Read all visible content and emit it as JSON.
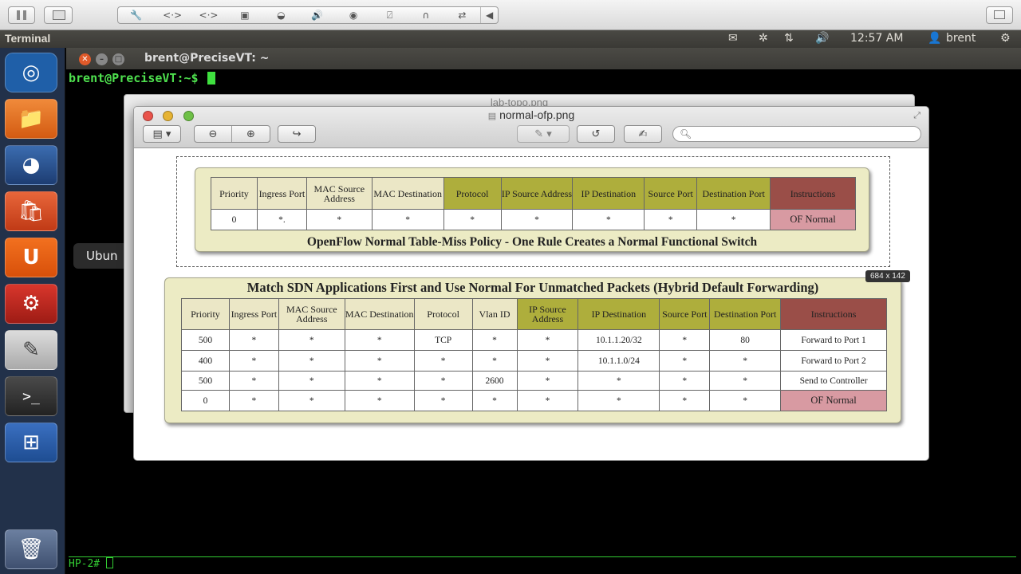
{
  "terminal": {
    "window_title": "brent@PreciseVT: ~",
    "prompt": "brent@PreciseVT:~$",
    "bottom_prompt": "HP-2#"
  },
  "top_panel": {
    "app_name": "Terminal",
    "time": "12:57 AM",
    "user": "brent"
  },
  "launcher": {
    "tooltip": "Ubun",
    "items": [
      "ubuntu-dash",
      "files",
      "firefox",
      "software-center",
      "ubuntu-one",
      "system-settings",
      "text-editor",
      "terminal",
      "workspace-switcher",
      "trash"
    ]
  },
  "preview": {
    "back_title": "lab-topo.png",
    "front_title": "normal-ofp.png",
    "selection_size": "684 x 142"
  },
  "table1": {
    "headers": [
      "Priority",
      "Ingress Port",
      "MAC Source Address",
      "MAC Destination",
      "Protocol",
      "IP Source Address",
      "IP Destination",
      "Source Port",
      "Destination Port",
      "Instructions"
    ],
    "row": [
      "0",
      "*.",
      "*",
      "*",
      "*",
      "*",
      "*",
      "*",
      "*",
      "OF Normal"
    ],
    "caption": "OpenFlow Normal Table-Miss Policy - One Rule Creates a Normal Functional Switch"
  },
  "table2": {
    "title": "Match SDN Applications First and Use Normal For Unmatched Packets (Hybrid Default Forwarding)",
    "headers": [
      "Priority",
      "Ingress Port",
      "MAC Source Address",
      "MAC Destination",
      "Protocol",
      "Vlan ID",
      "IP Source Address",
      "IP Destination",
      "Source Port",
      "Destination Port",
      "Instructions"
    ],
    "rows": [
      [
        "500",
        "*",
        "*",
        "*",
        "TCP",
        "*",
        "*",
        "10.1.1.20/32",
        "*",
        "80",
        "Forward to Port 1"
      ],
      [
        "400",
        "*",
        "*",
        "*",
        "*",
        "*",
        "*",
        "10.1.1.0/24",
        "*",
        "*",
        "Forward to Port 2"
      ],
      [
        "500",
        "*",
        "*",
        "*",
        "*",
        "2600",
        "*",
        "*",
        "*",
        "*",
        "Send to Controller"
      ],
      [
        "0",
        "*",
        "*",
        "*",
        "*",
        "*",
        "*",
        "*",
        "*",
        "*",
        "OF Normal"
      ]
    ]
  }
}
